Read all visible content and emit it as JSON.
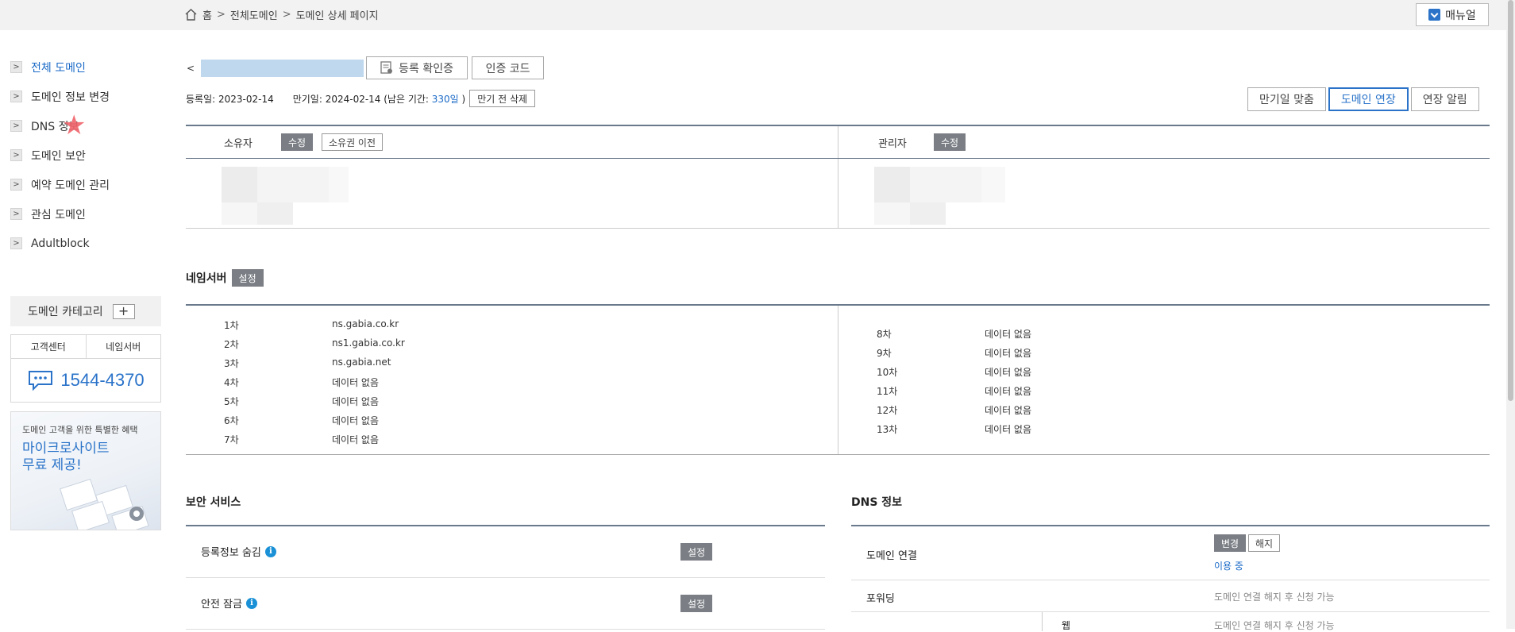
{
  "breadcrumb": {
    "home": "홈",
    "sep": ">",
    "all": "전체도메인",
    "detail": "도메인 상세 페이지"
  },
  "manual_label": "매뉴얼",
  "sidebar": {
    "items": [
      {
        "label": "전체 도메인",
        "active": true
      },
      {
        "label": "도메인 정보 변경"
      },
      {
        "label": "DNS 정보"
      },
      {
        "label": "도메인 보안"
      },
      {
        "label": "예약 도메인 관리"
      },
      {
        "label": "관심 도메인"
      },
      {
        "label": "Adultblock"
      }
    ],
    "category_label": "도메인 카테고리",
    "category_add": "+",
    "cs_tabs": [
      "고객센터",
      "네임서버"
    ],
    "phone": "1544-4370",
    "promo_sub": "도메인 고객을 위한 특별한 혜택",
    "promo_big": "마이크로사이트\n무료 제공!"
  },
  "domain": {
    "back": "<",
    "cert_button": "등록 확인증",
    "auth_button": "인증 코드",
    "registered": "등록일: 2023-02-14",
    "expire_prefix": "만기일: 2024-02-14 (남은 기간: ",
    "remain": "330일",
    "expire_suffix": " )",
    "pre_delete": "만기 전 삭제",
    "actions": [
      "만기일 맞춤",
      "도메인 연장",
      "연장 알림"
    ]
  },
  "owner": {
    "owner_label": "소유자",
    "edit": "수정",
    "transfer": "소유권 이전",
    "admin_label": "관리자"
  },
  "nameserver": {
    "title": "네임서버",
    "set": "설정",
    "left": [
      {
        "ord": "1차",
        "val": "ns.gabia.co.kr"
      },
      {
        "ord": "2차",
        "val": "ns1.gabia.co.kr"
      },
      {
        "ord": "3차",
        "val": "ns.gabia.net"
      },
      {
        "ord": "4차",
        "val": "데이터 없음"
      },
      {
        "ord": "5차",
        "val": "데이터 없음"
      },
      {
        "ord": "6차",
        "val": "데이터 없음"
      },
      {
        "ord": "7차",
        "val": "데이터 없음"
      }
    ],
    "right": [
      {
        "ord": "8차",
        "val": "데이터 없음"
      },
      {
        "ord": "9차",
        "val": "데이터 없음"
      },
      {
        "ord": "10차",
        "val": "데이터 없음"
      },
      {
        "ord": "11차",
        "val": "데이터 없음"
      },
      {
        "ord": "12차",
        "val": "데이터 없음"
      },
      {
        "ord": "13차",
        "val": "데이터 없음"
      }
    ]
  },
  "security": {
    "title": "보안 서비스",
    "rows": [
      {
        "label": "등록정보 숨김",
        "button": "설정"
      },
      {
        "label": "안전 잠금",
        "button": "설정"
      }
    ]
  },
  "dns": {
    "title": "DNS 정보",
    "connect_label": "도메인 연결",
    "change": "변경",
    "release": "해지",
    "in_use": "이용 중",
    "forward_label": "포워딩",
    "forward_val": "도메인 연결 해지 후 신청 가능",
    "sub_label": "웹",
    "sub_val": "도메인 연결 해지 후 신청 가능"
  },
  "colors": {
    "accent": "#2a73c9",
    "tag": "#7b7f85",
    "rule": "#6a7a8c"
  }
}
